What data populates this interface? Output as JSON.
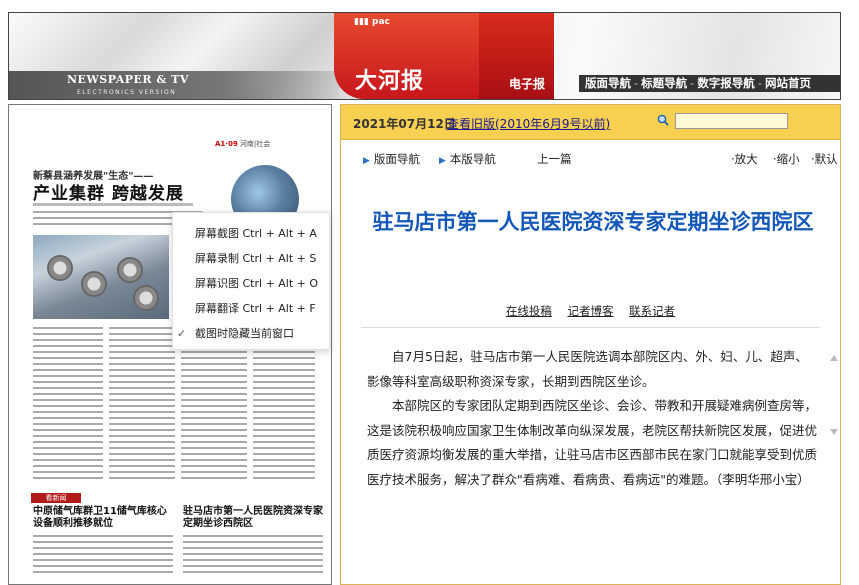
{
  "header": {
    "newspaper_tv": "NEWSPAPER & TV",
    "electronics_version": "ELECTRONICS VERSION",
    "logo_small": "pac",
    "logo": "大河报",
    "epaper": "电子报",
    "nav": [
      "版面导航",
      "标题导航",
      "数字报导航",
      "网站首页"
    ]
  },
  "paper": {
    "page_info": "A1·09",
    "section": "河南|社会",
    "sub_headline": "新蔡县涵养发展\"生态\"——",
    "main_headline": "产业集群  跨越发展",
    "bottom_tag": "看新闻",
    "bottom_headline_1": "中原储气库群卫11储气库核心设备顺利推移就位",
    "bottom_headline_2": "驻马店市第一人民医院资深专家定期坐诊西院区"
  },
  "context_menu": {
    "items": [
      "屏幕截图 Ctrl + Alt + A",
      "屏幕录制 Ctrl + Alt + S",
      "屏幕识图 Ctrl + Alt + O",
      "屏幕翻译 Ctrl + Alt + F",
      "截图时隐藏当前窗口"
    ],
    "checked_index": 4
  },
  "article": {
    "date": "2021年07月12日",
    "old_edition_link": "查看旧版(2010年6月9号以前)",
    "search_value": "",
    "nav_left": [
      "版面导航",
      "本版导航",
      "上一篇"
    ],
    "nav_right": [
      "放大",
      "缩小",
      "默认"
    ],
    "title": "驻马店市第一人民医院资深专家定期坐诊西院区",
    "links": [
      "在线投稿",
      "记者博客",
      "联系记者"
    ],
    "paragraphs": [
      "自7月5日起，驻马店市第一人民医院选调本部院区内、外、妇、儿、超声、影像等科室高级职称资深专家，长期到西院区坐诊。",
      "本部院区的专家团队定期到西院区坐诊、会诊、带教和开展疑难病例查房等，这是该院积极响应国家卫生体制改革向纵深发展，老院区帮扶新院区发展，促进优质医疗资源均衡发展的重大举措，让驻马店市区西部市民在家门口就能享受到优质医疗技术服务，解决了群众\"看病难、看病贵、看病远\"的难题。（李明华邢小宝）"
    ]
  },
  "colors": {
    "brand_red": "#c8161d",
    "topbar_yellow": "#f7cf51",
    "title_blue": "#1357b8",
    "nav_triangle_blue": "#2a73c4"
  }
}
